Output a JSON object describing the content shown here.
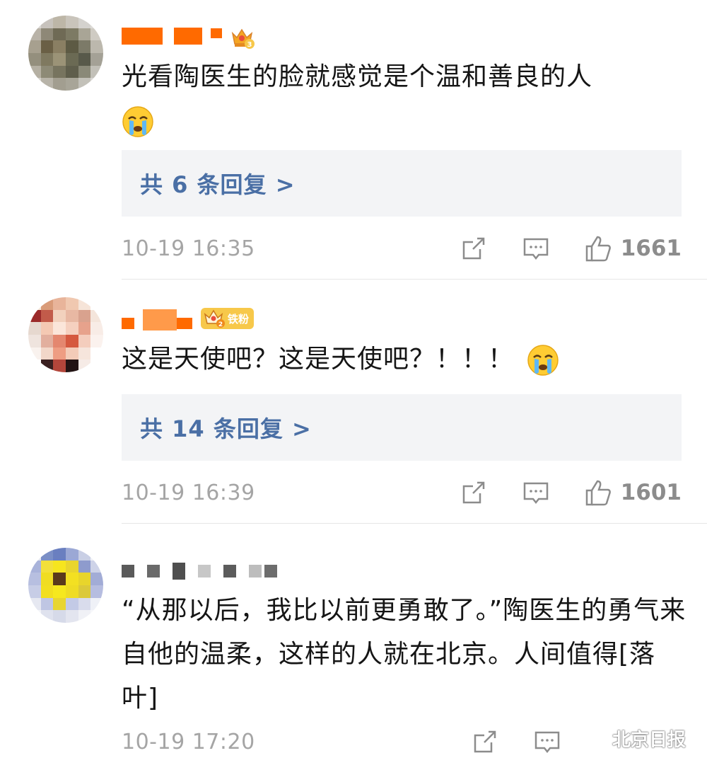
{
  "comments": [
    {
      "text": "光看陶医生的脸就感觉是个温和善良的人",
      "emoji": "crying-face",
      "badge": "",
      "reply_label": "共 6 条回复 >",
      "time": "10-19 16:35",
      "likes": "1661"
    },
    {
      "text": "这是天使吧？这是天使吧？！！！",
      "emoji": "crying-face",
      "badge": "铁粉",
      "reply_label": "共 14 条回复 >",
      "time": "10-19 16:39",
      "likes": "1601"
    },
    {
      "text": "“从那以后，我比以前更勇敢了。”陶医生的勇气来自他的温柔，这样的人就在北京。人间值得[落叶]",
      "time": "10-19 17:20"
    }
  ],
  "watermark": "北京日报",
  "colors": {
    "reply_text": "#4a6fa5",
    "reply_bg": "#f3f4f6",
    "timestamp": "#a5a5a5",
    "name_block": "#ff6a00",
    "badge": "#f7c84a"
  },
  "icons": [
    "share-icon",
    "comment-icon",
    "like-icon",
    "crying-face-emoji",
    "crown-badge-icon",
    "wechat-icon"
  ]
}
